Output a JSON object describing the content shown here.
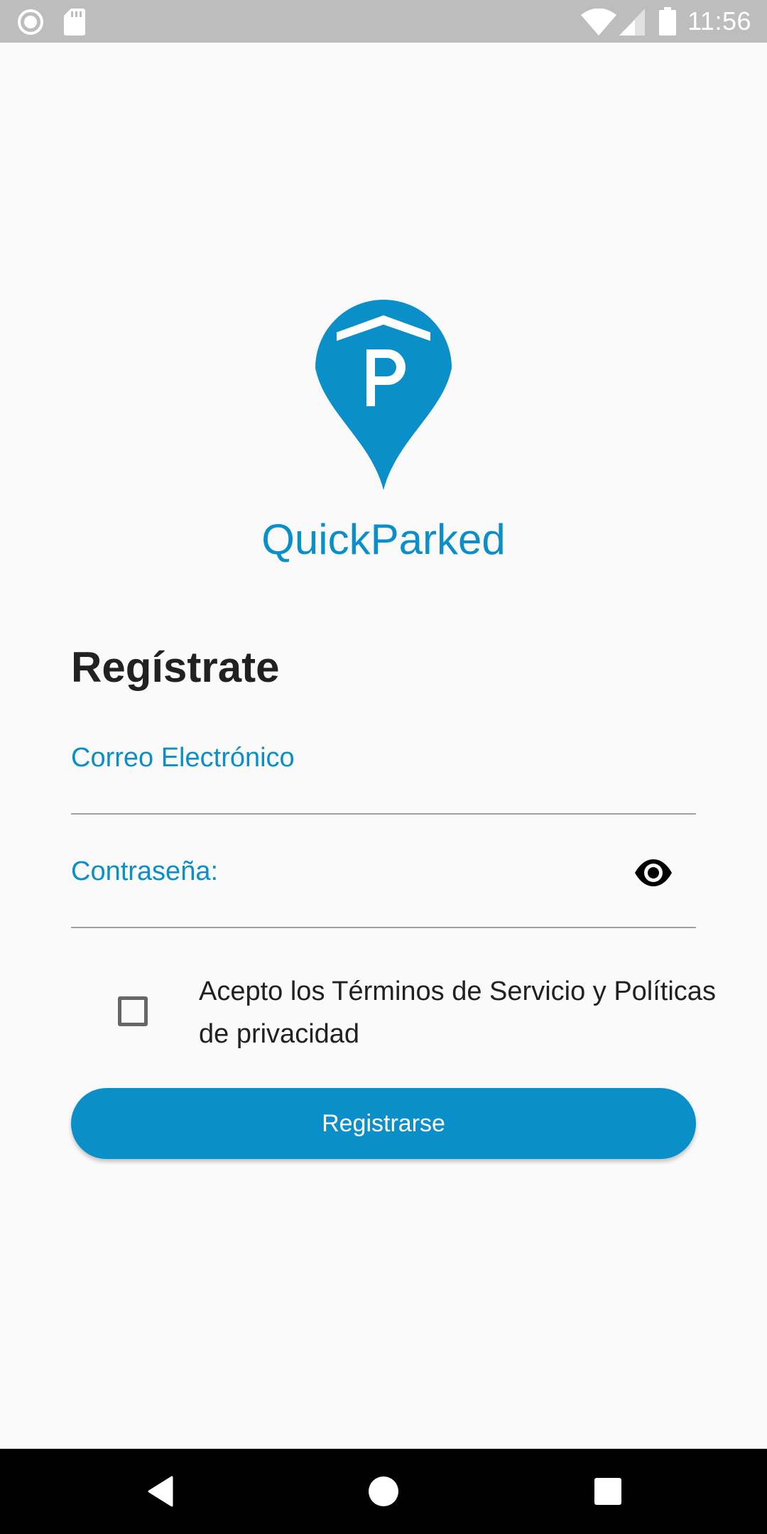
{
  "status_bar": {
    "time": "11:56",
    "icons": [
      "record-icon",
      "sd-card-icon",
      "wifi-icon",
      "signal-icon",
      "battery-icon"
    ]
  },
  "app": {
    "name": "QuickParked",
    "logo_icon": "parking-pin-icon",
    "brand_color": "#0b8fc8"
  },
  "form": {
    "title": "Regístrate",
    "email": {
      "label": "Correo Electrónico",
      "value": ""
    },
    "password": {
      "label": "Contraseña:",
      "value": "",
      "toggle_icon": "eye-icon"
    },
    "terms": {
      "checked": false,
      "text": "Acepto los Términos de Servicio y Políticas de privacidad"
    },
    "submit_label": "Registrarse"
  },
  "nav_bar": {
    "buttons": [
      "back-icon",
      "home-icon",
      "recents-icon"
    ]
  }
}
